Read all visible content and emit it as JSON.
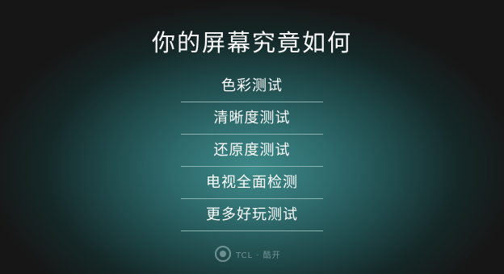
{
  "title": "你的屏幕究竟如何",
  "menu": {
    "items": [
      {
        "label": "色彩测试"
      },
      {
        "label": "清晰度测试"
      },
      {
        "label": "还原度测试"
      },
      {
        "label": "电视全面检测"
      },
      {
        "label": "更多好玩测试"
      }
    ]
  },
  "brand": {
    "logo_icon": "brand-logo-icon",
    "text": "TCL · 酷开"
  }
}
